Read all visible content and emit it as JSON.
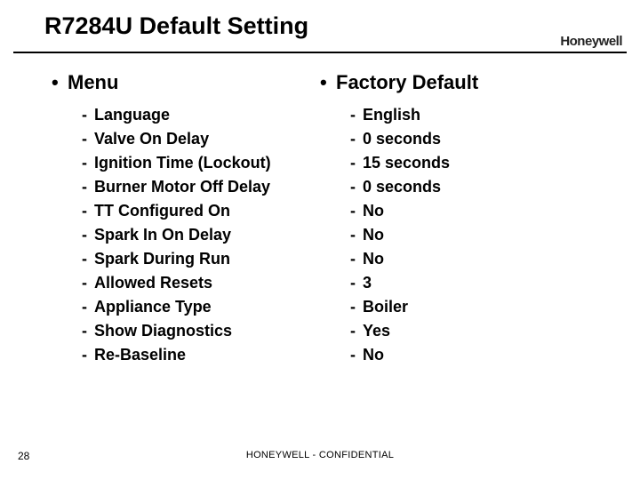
{
  "title": "R7284U Default Setting",
  "brand": "Honeywell",
  "columns": {
    "left": {
      "heading": "Menu",
      "items": [
        "Language",
        "Valve On Delay",
        "Ignition Time (Lockout)",
        "Burner Motor Off Delay",
        "TT Configured On",
        "Spark In On Delay",
        "Spark During Run",
        "Allowed Resets",
        "Appliance Type",
        "Show Diagnostics",
        "Re-Baseline"
      ]
    },
    "right": {
      "heading": "Factory Default",
      "items": [
        "English",
        "0 seconds",
        "15 seconds",
        "0 seconds",
        "No",
        "No",
        "No",
        "3",
        "Boiler",
        "Yes",
        "No"
      ]
    }
  },
  "footer": "HONEYWELL - CONFIDENTIAL",
  "page_number": "28"
}
